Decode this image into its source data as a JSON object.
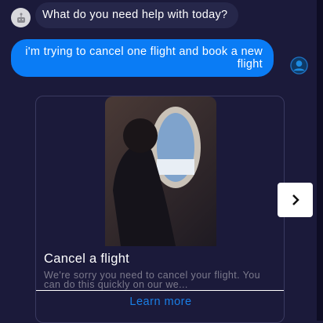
{
  "chat": {
    "bot_message": "What do you need help with today?",
    "user_message": "i'm trying to cancel one flight and book a new flight"
  },
  "card": {
    "title": "Cancel a flight",
    "description": "We're sorry you need to cancel your flight. You can do this quickly on our we...",
    "link": "Learn more",
    "image": "woman looking out airplane window"
  },
  "colors": {
    "accent": "#0a7cf5",
    "background": "#1b1a3a"
  }
}
